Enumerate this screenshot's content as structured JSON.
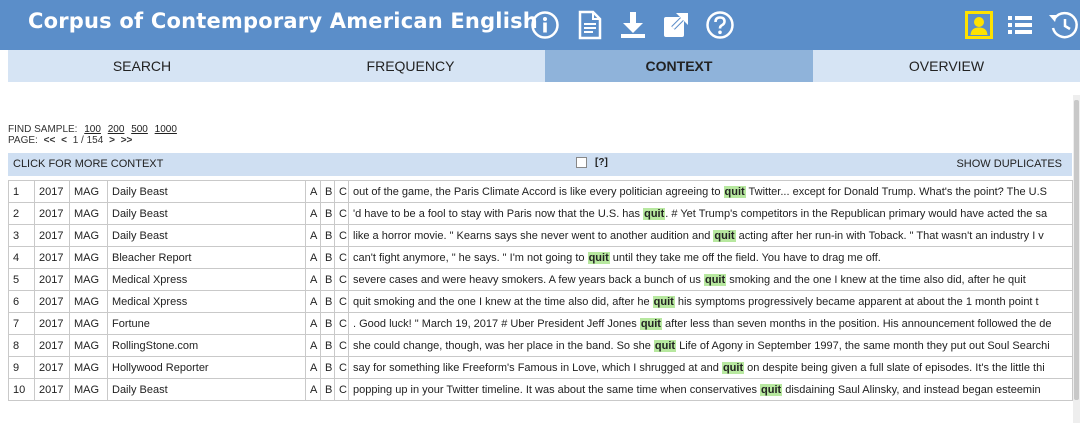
{
  "header": {
    "title": "Corpus of Contemporary American English",
    "icons": [
      "info-icon",
      "document-icon",
      "download-icon",
      "external-link-icon",
      "help-icon",
      "user-icon",
      "list-icon",
      "history-icon"
    ],
    "accent": "#5b8ec9",
    "user_icon_color": "#ffe200"
  },
  "tabs": [
    "SEARCH",
    "FREQUENCY",
    "CONTEXT",
    "OVERVIEW"
  ],
  "active_tab": "CONTEXT",
  "find_sample": {
    "label": "FIND SAMPLE:",
    "options": [
      "100",
      "200",
      "500",
      "1000"
    ]
  },
  "pager": {
    "label": "PAGE:",
    "first": "<<",
    "prev": "<",
    "current": "1 / 154",
    "next": ">",
    "last": ">>"
  },
  "context_bar": {
    "more_context": "CLICK FOR MORE CONTEXT",
    "help": "[?]",
    "show_duplicates": "SHOW DUPLICATES"
  },
  "results": [
    {
      "num": "1",
      "year": "2017",
      "genre": "MAG",
      "source": "Daily Beast",
      "a": "A",
      "b": "B",
      "c": "C",
      "before": "out of the game, the Paris Climate Accord is like every politician agreeing to ",
      "keyword": "quit",
      "after": " Twitter... except for Donald Trump. What's the point? The U.S"
    },
    {
      "num": "2",
      "year": "2017",
      "genre": "MAG",
      "source": "Daily Beast",
      "a": "A",
      "b": "B",
      "c": "C",
      "before": "'d have to be a fool to stay with Paris now that the U.S. has ",
      "keyword": "quit",
      "after": ". # Yet Trump's competitors in the Republican primary would have acted the sa"
    },
    {
      "num": "3",
      "year": "2017",
      "genre": "MAG",
      "source": "Daily Beast",
      "a": "A",
      "b": "B",
      "c": "C",
      "before": "like a horror movie. \" Kearns says she never went to another audition and ",
      "keyword": "quit",
      "after": " acting after her run-in with Toback. \" That wasn't an industry I v"
    },
    {
      "num": "4",
      "year": "2017",
      "genre": "MAG",
      "source": "Bleacher Report",
      "a": "A",
      "b": "B",
      "c": "C",
      "before": "can't fight anymore, \" he says. \" I'm not going to ",
      "keyword": "quit",
      "after": " until they take me off the field. You have to drag me off."
    },
    {
      "num": "5",
      "year": "2017",
      "genre": "MAG",
      "source": "Medical Xpress",
      "a": "A",
      "b": "B",
      "c": "C",
      "before": "severe cases and were heavy smokers. A few years back a bunch of us ",
      "keyword": "quit",
      "after": " smoking and the one I knew at the time also did, after he quit"
    },
    {
      "num": "6",
      "year": "2017",
      "genre": "MAG",
      "source": "Medical Xpress",
      "a": "A",
      "b": "B",
      "c": "C",
      "before": "quit smoking and the one I knew at the time also did, after he ",
      "keyword": "quit",
      "after": " his symptoms progressively became apparent at about the 1 month point t"
    },
    {
      "num": "7",
      "year": "2017",
      "genre": "MAG",
      "source": "Fortune",
      "a": "A",
      "b": "B",
      "c": "C",
      "before": ". Good luck! \" March 19, 2017 # Uber President Jeff Jones ",
      "keyword": "quit",
      "after": " after less than seven months in the position. His announcement followed the de"
    },
    {
      "num": "8",
      "year": "2017",
      "genre": "MAG",
      "source": "RollingStone.com",
      "a": "A",
      "b": "B",
      "c": "C",
      "before": "she could change, though, was her place in the band. So she ",
      "keyword": "quit",
      "after": " Life of Agony in September 1997, the same month they put out Soul Searchi"
    },
    {
      "num": "9",
      "year": "2017",
      "genre": "MAG",
      "source": "Hollywood Reporter",
      "a": "A",
      "b": "B",
      "c": "C",
      "before": "say for something like Freeform's Famous in Love, which I shrugged at and ",
      "keyword": "quit",
      "after": " on despite being given a full slate of episodes. It's the little thi"
    },
    {
      "num": "10",
      "year": "2017",
      "genre": "MAG",
      "source": "Daily Beast",
      "a": "A",
      "b": "B",
      "c": "C",
      "before": "popping up in your Twitter timeline. It was about the same time when conservatives ",
      "keyword": "quit",
      "after": " disdaining Saul Alinsky, and instead began esteemin"
    }
  ]
}
